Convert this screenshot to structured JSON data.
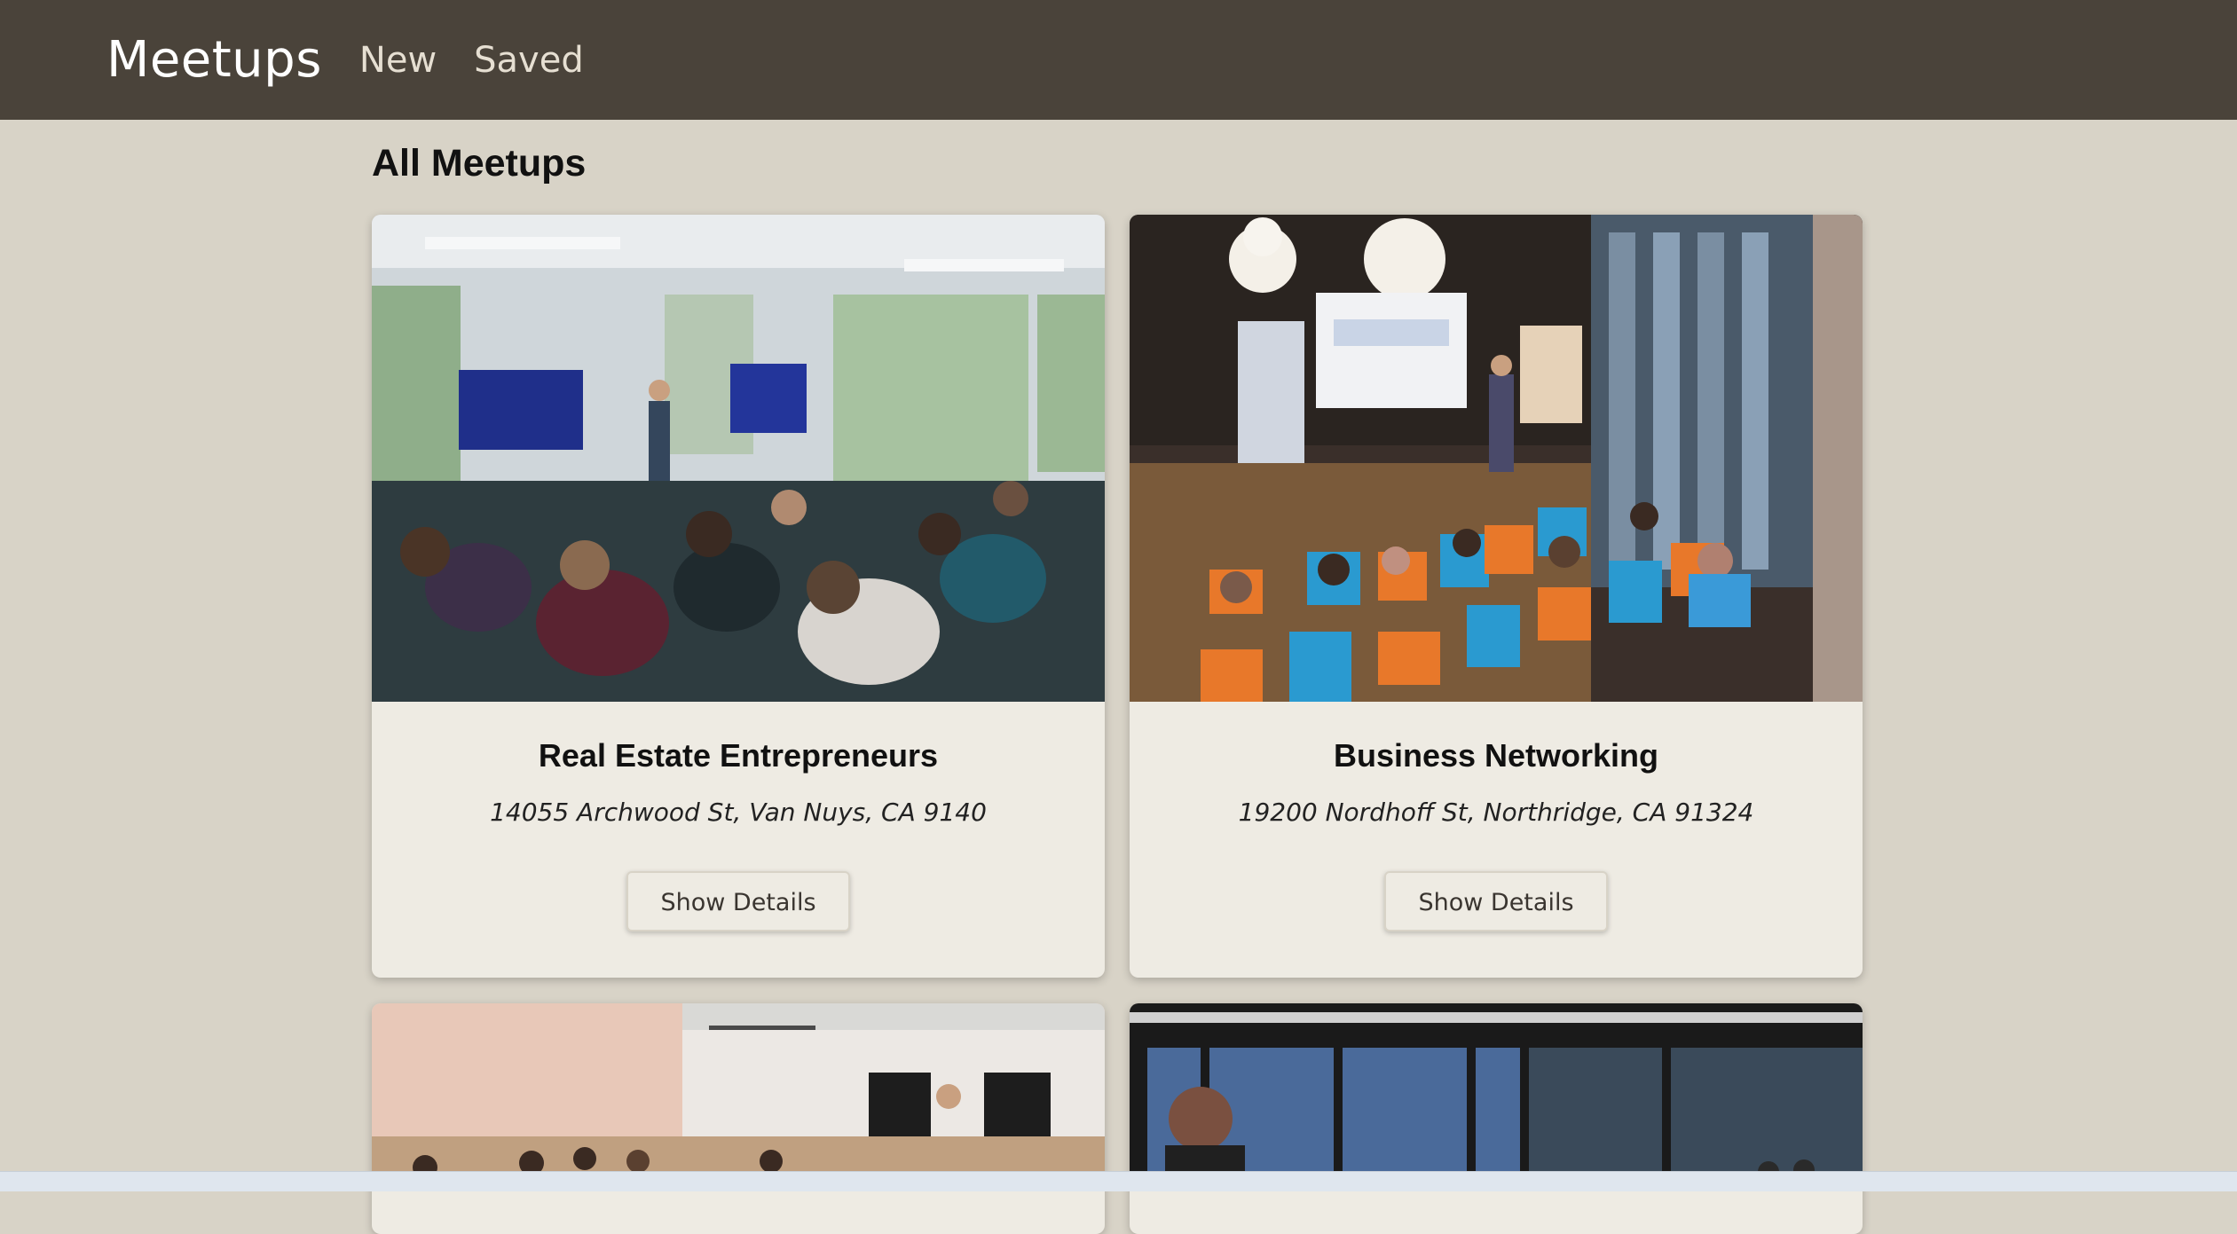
{
  "nav": {
    "brand": "Meetups",
    "links": [
      "New",
      "Saved"
    ]
  },
  "page": {
    "title": "All Meetups"
  },
  "meetups": [
    {
      "title": "Real Estate Entrepreneurs",
      "address": "14055 Archwood St, Van Nuys, CA 9140",
      "button": "Show Details"
    },
    {
      "title": "Business Networking",
      "address": "19200 Nordhoff St, Northridge, CA 91324",
      "button": "Show Details"
    }
  ],
  "colors": {
    "navbar": "#4a433a",
    "background": "#d8d3c7",
    "card": "#eeebe3"
  }
}
